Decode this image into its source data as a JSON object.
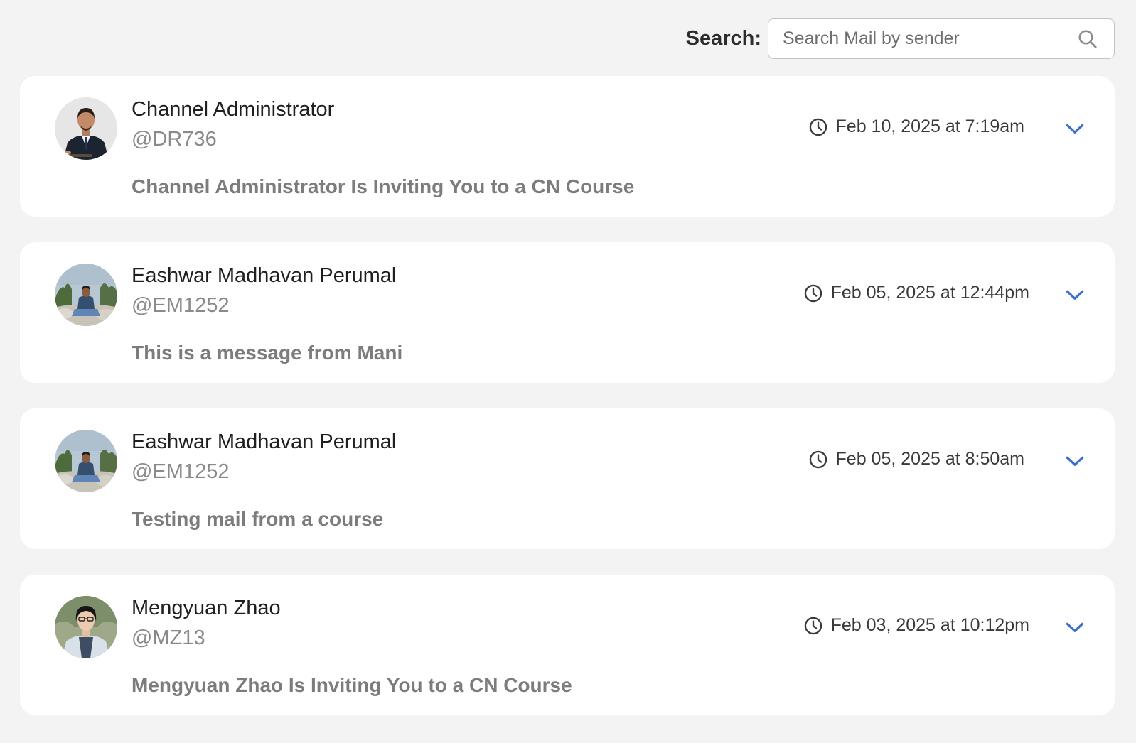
{
  "search": {
    "label": "Search:",
    "placeholder": "Search Mail by sender",
    "icon": "search-icon"
  },
  "colors": {
    "page_background": "#f3f3f3",
    "card_background": "#ffffff",
    "chevron": "#3b6ed1"
  },
  "mails": [
    {
      "name": "Channel Administrator",
      "handle": "@DR736",
      "time": "Feb 10, 2025 at 7:19am",
      "subject": "Channel Administrator Is Inviting You to a CN Course"
    },
    {
      "name": "Eashwar Madhavan Perumal",
      "handle": "@EM1252",
      "time": "Feb 05, 2025 at 12:44pm",
      "subject": "This is a message from Mani"
    },
    {
      "name": "Eashwar Madhavan Perumal",
      "handle": "@EM1252",
      "time": "Feb 05, 2025 at 8:50am",
      "subject": "Testing mail from a course"
    },
    {
      "name": "Mengyuan Zhao",
      "handle": "@MZ13",
      "time": "Feb 03, 2025 at 10:12pm",
      "subject": "Mengyuan Zhao Is Inviting You to a CN Course"
    }
  ]
}
